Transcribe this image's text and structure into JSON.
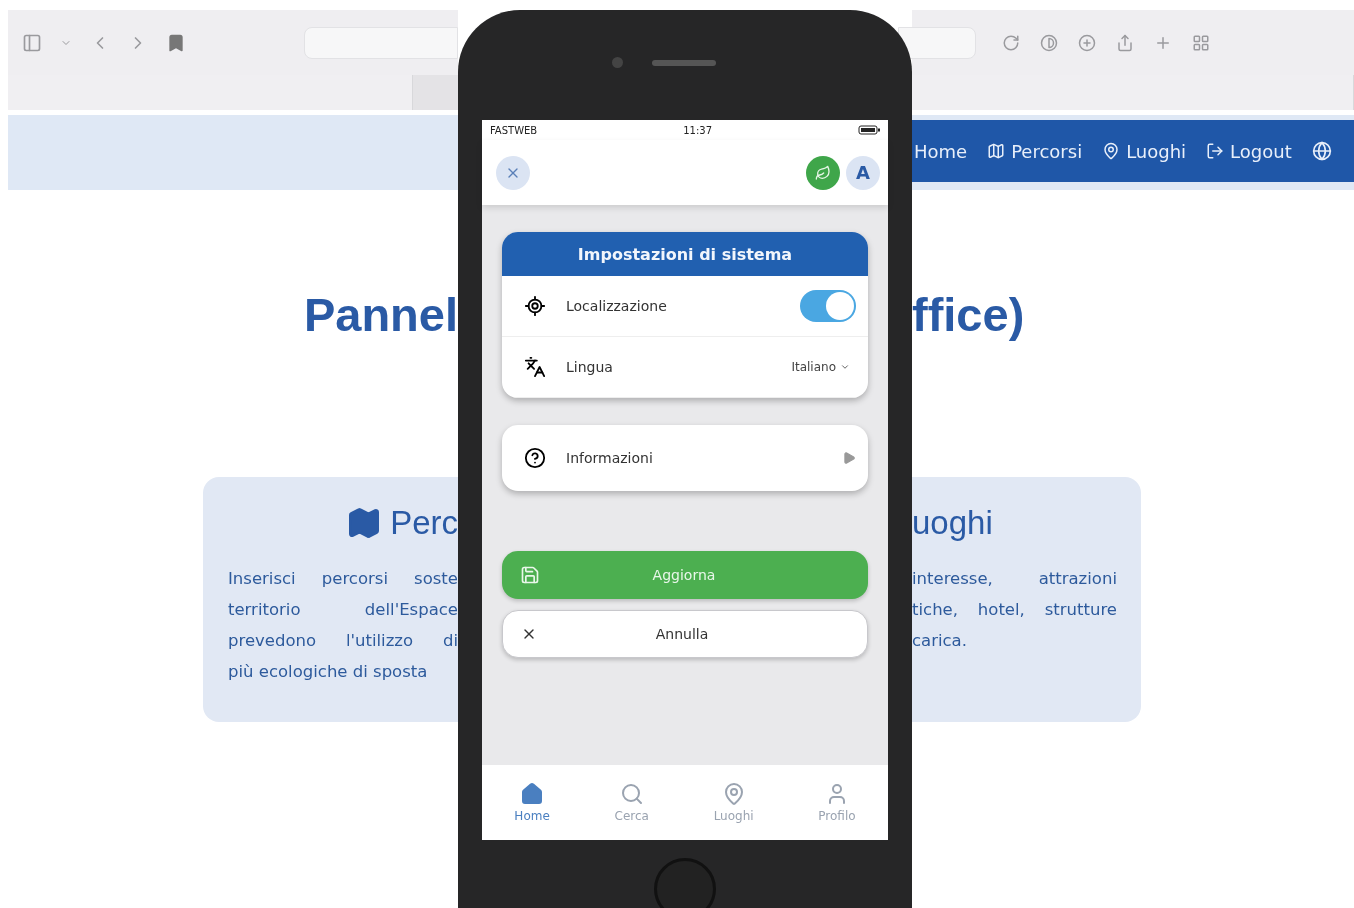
{
  "nav": {
    "items": [
      {
        "label": "Home"
      },
      {
        "label": "Percorsi"
      },
      {
        "label": "Luoghi"
      },
      {
        "label": "Logout"
      }
    ]
  },
  "title": {
    "left": "Pannel",
    "right": "ffice)"
  },
  "cards": [
    {
      "heading": "Perc",
      "lines": [
        "Inserisci percorsi soste",
        "territorio dell'Espace",
        "prevedono l'utilizzo di",
        "più ecologiche di sposta"
      ]
    },
    {
      "heading": "uoghi",
      "lines": [
        "interesse, attrazioni",
        "tiche, hotel, strutture",
        "carica."
      ]
    }
  ],
  "phone": {
    "status": {
      "carrier": "FASTWEB",
      "time": "11:37"
    },
    "header": {
      "avatar": "A"
    },
    "settings": {
      "title": "Impostazioni di sistema",
      "rows": [
        {
          "kind": "toggle",
          "label": "Localizzazione",
          "on": true
        },
        {
          "kind": "select",
          "label": "Lingua",
          "value": "Italiano"
        }
      ]
    },
    "info": {
      "label": "Informazioni"
    },
    "buttons": [
      {
        "kind": "primary",
        "label": "Aggiorna"
      },
      {
        "kind": "secondary",
        "label": "Annulla"
      }
    ],
    "tabs": [
      {
        "label": "Home",
        "selected": true
      },
      {
        "label": "Cerca",
        "selected": false
      },
      {
        "label": "Luoghi",
        "selected": false
      },
      {
        "label": "Profilo",
        "selected": false
      }
    ]
  }
}
